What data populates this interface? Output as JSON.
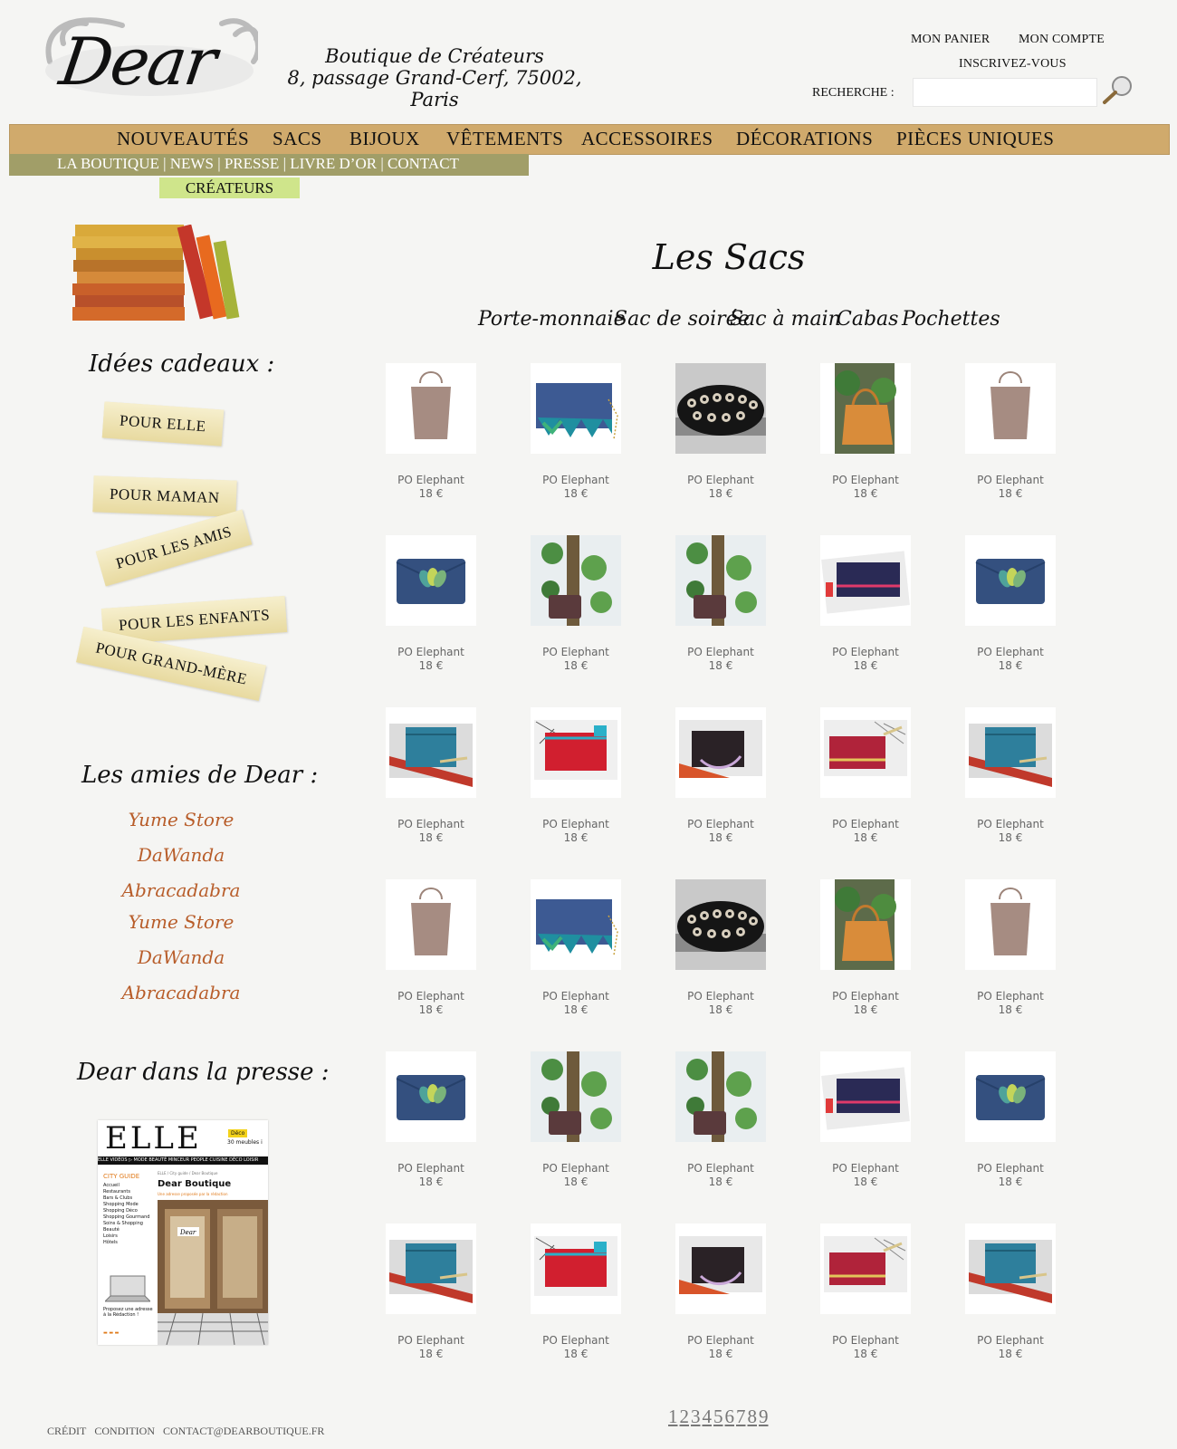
{
  "header": {
    "logo_text": "Dear",
    "tagline_line1": "Boutique de Créateurs",
    "tagline_line2": "8, passage Grand-Cerf, 75002, Paris",
    "cart_label": "MON PANIER",
    "account_label": "MON COMPTE",
    "register_label": "INSCRIVEZ-VOUS",
    "search_label": "RECHERCHE :",
    "search_value": ""
  },
  "nav": {
    "items": [
      "NOUVEAUTÉS",
      "SACS",
      "BIJOUX",
      "VÊTEMENTS",
      "ACCESSOIRES",
      "DÉCORATIONS",
      "PIÈCES UNIQUES"
    ],
    "sub_items": [
      "LA BOUTIQUE",
      "NEWS",
      "PRESSE",
      "LIVRE D’OR",
      "CONTACT"
    ],
    "sub_separator": " | ",
    "createurs": "CRÉATEURS"
  },
  "sidebar": {
    "gifts_heading": "Idées cadeaux :",
    "gift_tags": [
      "POUR ELLE",
      "POUR MAMAN",
      "POUR LES AMIS",
      "POUR LES ENFANTS",
      "POUR GRAND-MÈRE"
    ],
    "friends_heading": "Les amies de Dear :",
    "friends": [
      "Yume Store",
      "DaWanda",
      "Abracadabra",
      "Yume Store",
      "DaWanda",
      "Abracadabra"
    ],
    "press_heading": "Dear dans la presse :",
    "press": {
      "magazine": "ELLE",
      "badge": "Déco",
      "badge_sub": "30 meubles i",
      "menu_bar": "ELLE VIDÉOS ▷  MODE  BEAUTÉ  MINCEUR  PEOPLE  CUISINE  DÉCO  LOISIR",
      "city_guide": "CITY GUIDE",
      "guide_items": [
        "Accueil",
        "Restaurants",
        "Bars & Clubs",
        "Shopping Mode",
        "Shopping Déco",
        "Shopping Gourmand",
        "Soins & Shopping Beauté",
        "Loisirs",
        "Hôtels"
      ],
      "crumb": "ELLE / City guide / Dear Boutique",
      "article_title": "Dear Boutique",
      "article_sub": "Une adresse proposée par la rédaction",
      "propose": "Proposez une adresse à la Rédaction !",
      "storefront_sign": "Dear"
    }
  },
  "main": {
    "title": "Les Sacs",
    "categories": [
      "Porte-monnaie",
      "Sac de soirée",
      "Sac à main",
      "Cabas",
      "Pochettes"
    ],
    "product_name": "PO Elephant",
    "product_price": "18 €",
    "rows": [
      [
        "tote",
        "blue-feather",
        "beaded",
        "orange-tree",
        "tote"
      ],
      [
        "blue-clutch",
        "tree-pouch",
        "tree-pouch",
        "navy-zip",
        "blue-clutch"
      ],
      [
        "teal-zip",
        "red-zip",
        "black-zip",
        "crimson-zip",
        "teal-zip"
      ],
      [
        "tote",
        "blue-feather",
        "beaded",
        "orange-tree",
        "tote"
      ],
      [
        "blue-clutch",
        "tree-pouch",
        "tree-pouch",
        "navy-zip",
        "blue-clutch"
      ],
      [
        "teal-zip",
        "red-zip",
        "black-zip",
        "crimson-zip",
        "teal-zip"
      ]
    ]
  },
  "pagination": [
    "1",
    "2",
    "3",
    "4",
    "5",
    "6",
    "7",
    "8",
    "9"
  ],
  "footer": [
    "CRÉDIT",
    "CONDITION",
    "CONTACT@DEARBOUTIQUE.FR"
  ]
}
